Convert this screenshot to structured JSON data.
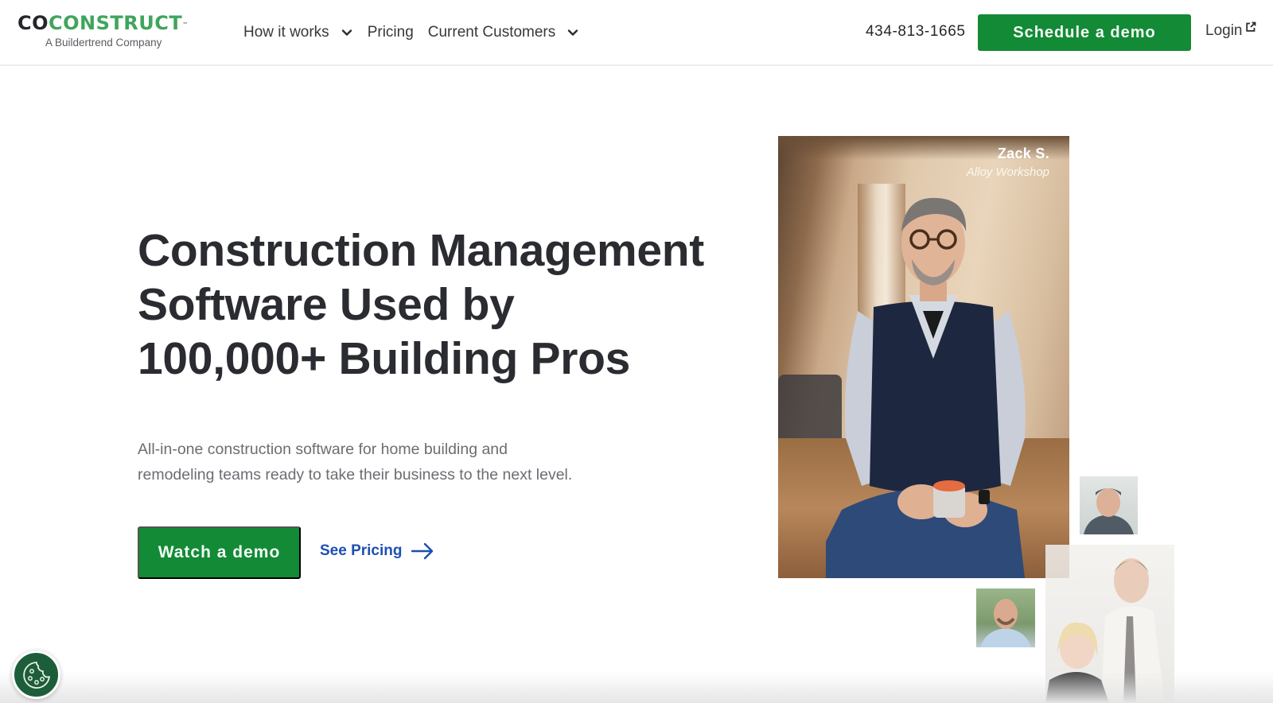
{
  "header": {
    "logo": {
      "word_dark": "CO",
      "word_green": "CONSTRUCT",
      "trademark": "™",
      "tagline": "A Buildertrend Company"
    },
    "nav": [
      {
        "label": "How it works",
        "has_dropdown": true,
        "icon": "chevron-down-icon"
      },
      {
        "label": "Pricing",
        "has_dropdown": false
      },
      {
        "label": "Current Customers",
        "has_dropdown": true,
        "icon": "chevron-down-icon"
      }
    ],
    "phone": "434-813-1665",
    "schedule_button": "Schedule a demo",
    "login": {
      "label": "Login",
      "icon": "external-link-icon"
    }
  },
  "hero": {
    "title_lines": [
      "Construction Management",
      "Software Used by",
      "100,000+ Building Pros"
    ],
    "subtitle_lines": [
      "All-in-one construction software for home building and",
      "remodeling teams ready to take their business to the next level."
    ],
    "primary_cta": "Watch a demo",
    "secondary_cta": {
      "label": "See Pricing",
      "icon": "arrow-right-icon"
    }
  },
  "testimonial_photo": {
    "name": "Zack S.",
    "company": "Alloy Workshop"
  },
  "cookie_settings": {
    "icon": "cookie-icon"
  },
  "colors": {
    "brand_green": "#138a36",
    "logo_green": "#3fa55c",
    "link_blue": "#1d4fb3",
    "heading": "#2a2c31",
    "cookie_bg": "#1d5e3a"
  }
}
